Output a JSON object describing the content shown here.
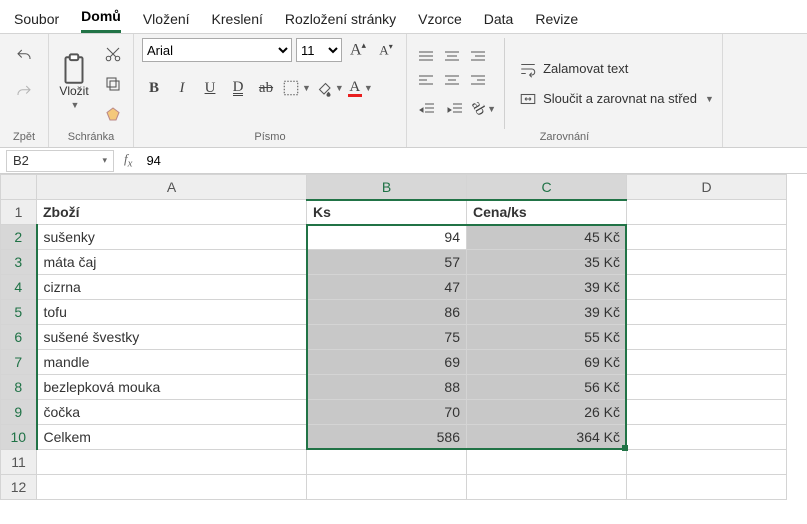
{
  "menu": {
    "tabs": [
      "Soubor",
      "Domů",
      "Vložení",
      "Kreslení",
      "Rozložení stránky",
      "Vzorce",
      "Data",
      "Revize"
    ],
    "active": 1
  },
  "history": {
    "undo": "Zpět"
  },
  "clipboard": {
    "paste": "Vložit",
    "group": "Schránka"
  },
  "font": {
    "name": "Arial",
    "size": "11",
    "bold": "B",
    "italic": "I",
    "underline": "U",
    "double_underline": "D",
    "group": "Písmo"
  },
  "alignment": {
    "wrap": "Zalamovat text",
    "merge": "Sloučit a zarovnat na střed",
    "group": "Zarovnání"
  },
  "namebox": "B2",
  "formula": "94",
  "columns": [
    "A",
    "B",
    "C",
    "D"
  ],
  "headers": {
    "A": "Zboží",
    "B": "Ks",
    "C": "Cena/ks"
  },
  "rows": [
    {
      "n": 2,
      "A": "sušenky",
      "B": "94",
      "C": "45 Kč"
    },
    {
      "n": 3,
      "A": "máta čaj",
      "B": "57",
      "C": "35 Kč"
    },
    {
      "n": 4,
      "A": "cizrna",
      "B": "47",
      "C": "39 Kč"
    },
    {
      "n": 5,
      "A": "tofu",
      "B": "86",
      "C": "39 Kč"
    },
    {
      "n": 6,
      "A": "sušené švestky",
      "B": "75",
      "C": "55 Kč"
    },
    {
      "n": 7,
      "A": "mandle",
      "B": "69",
      "C": "69 Kč"
    },
    {
      "n": 8,
      "A": "bezlepková mouka",
      "B": "88",
      "C": "56 Kč"
    },
    {
      "n": 9,
      "A": "čočka",
      "B": "70",
      "C": "26 Kč"
    },
    {
      "n": 10,
      "A": "Celkem",
      "B": "586",
      "C": "364 Kč"
    }
  ],
  "selection": {
    "cols": [
      "B",
      "C"
    ],
    "rows": [
      2,
      3,
      4,
      5,
      6,
      7,
      8,
      9,
      10
    ],
    "active": "B2"
  }
}
